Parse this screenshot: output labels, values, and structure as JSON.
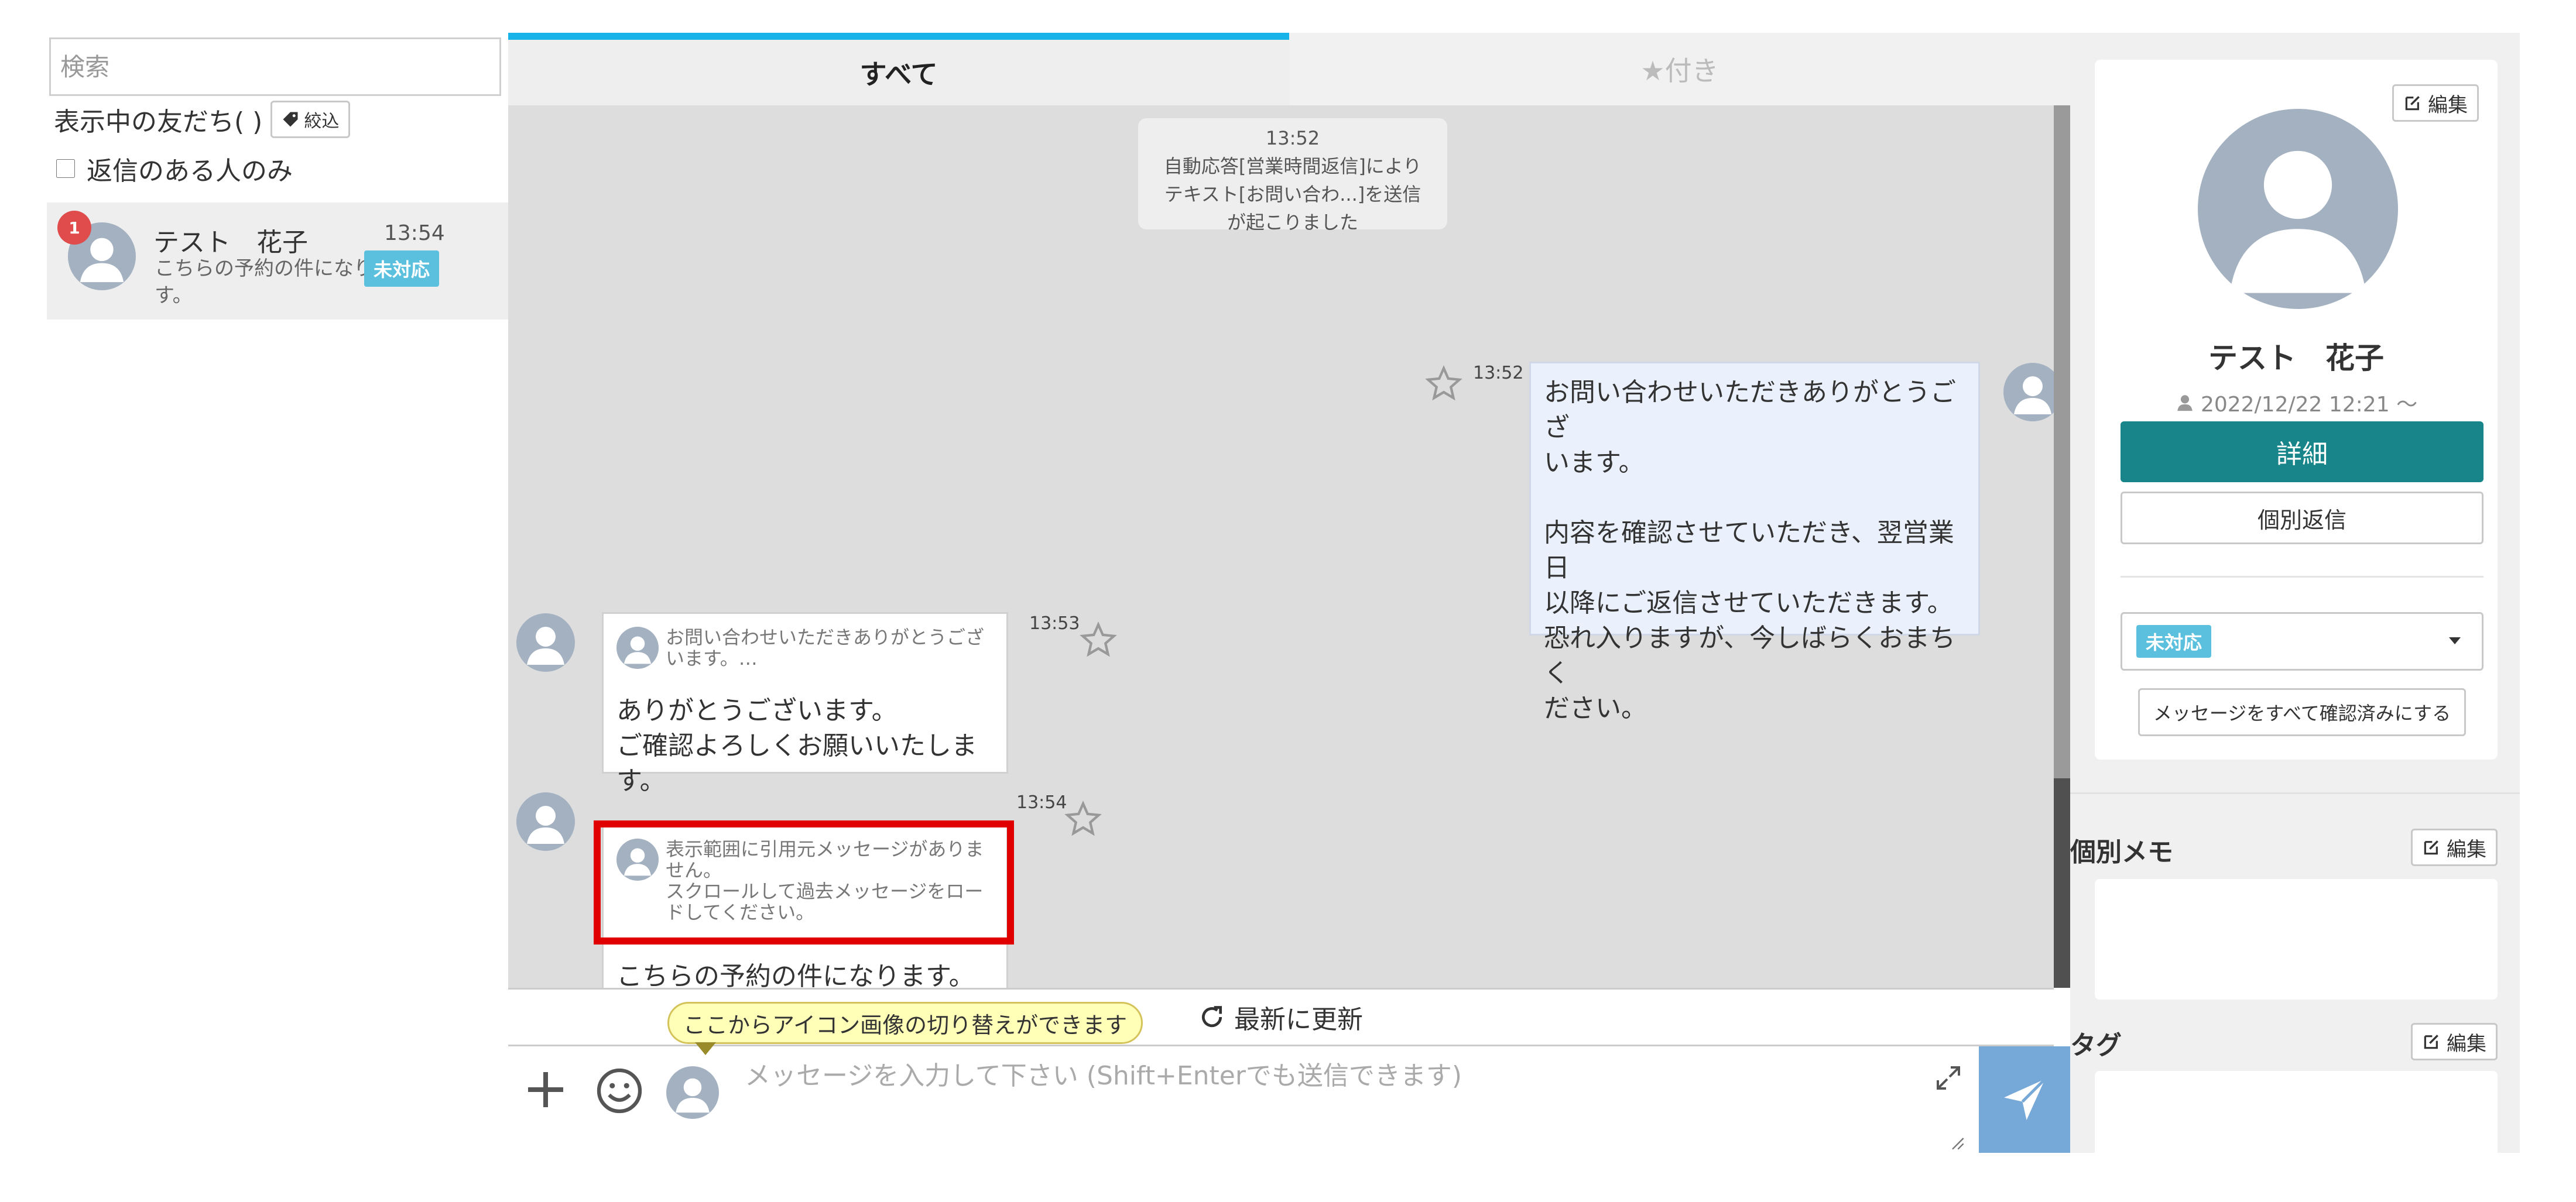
{
  "left": {
    "search_placeholder": "検索",
    "friends_label": "表示中の友だち(  )",
    "filter_label": "絞込",
    "reply_only_label": "返信のある人のみ",
    "friend": {
      "unread": "1",
      "name": "テスト　花子",
      "time": "13:54",
      "preview": "こちらの予約の件になります。",
      "status": "未対応"
    }
  },
  "center": {
    "tabs": [
      {
        "label": "すべて",
        "active": true
      },
      {
        "label": "★付き",
        "active": false
      }
    ],
    "messages": {
      "system": {
        "time": "13:52",
        "text": "自動応答[営業時間返信]により\nテキスト[お問い合わ...]を送信\nが起こりました"
      },
      "outgoing": {
        "time": "13:52",
        "text": "お問い合わせいただきありがとうござ\nいます。\n\n内容を確認させていただき、翌営業日\n以降にご返信させていただきます。\n恐れ入りますが、今しばらくおまちく\nださい。"
      },
      "incoming_1": {
        "time": "13:53",
        "quote": "お問い合わせいただきありがとうござ\nいます。…",
        "text": "ありがとうございます。\nご確認よろしくお願いいたします。"
      },
      "incoming_2": {
        "time": "13:54",
        "quote": "表示範囲に引用元メッセージがありま\nせん。\nスクロールして過去メッセージをロー\nドしてください。",
        "text": "こちらの予約の件になります。"
      }
    },
    "refresh_label": "最新に更新",
    "tooltip": "ここからアイコン画像の切り替えができます",
    "input_placeholder": "メッセージを入力して下さい (Shift+Enterでも送信できます)"
  },
  "right": {
    "edit_label": "編集",
    "profile_name": "テスト　花子",
    "registered": "2022/12/22 12:21 〜",
    "detail_label": "詳細",
    "reply_label": "個別返信",
    "status": "未対応",
    "confirm_all_label": "メッセージをすべて確認済みにする",
    "memo_title": "個別メモ",
    "tag_title": "タグ"
  },
  "colors": {
    "accent_tab": "#18b4e9",
    "status_badge": "#5bc0de",
    "detail_button": "#17858a",
    "unread_badge": "#e04b4b",
    "highlight": "#e00000",
    "send_button": "#76a8d8"
  }
}
